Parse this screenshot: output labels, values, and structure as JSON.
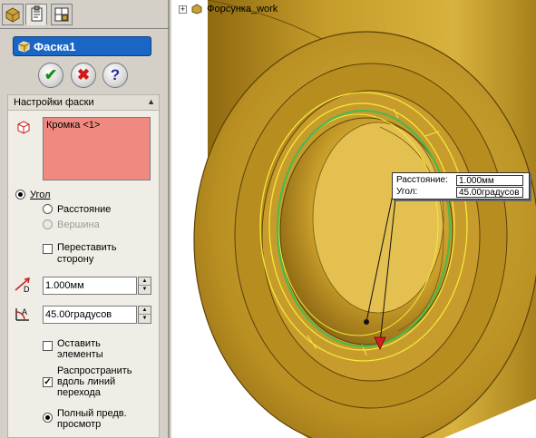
{
  "property_manager": {
    "tabs": [
      {
        "icon": "feature-manager-icon",
        "active": false
      },
      {
        "icon": "property-manager-icon",
        "active": true
      },
      {
        "icon": "configuration-manager-icon",
        "active": false
      }
    ],
    "feature_title": "Фаска1",
    "buttons": {
      "ok_icon": "checkmark-icon",
      "cancel_icon": "x-icon",
      "help_label": "?"
    },
    "group_title": "Настройки фаски",
    "selection": {
      "items": [
        "Кромка <1>"
      ]
    },
    "options": {
      "angle_label": "Угол",
      "distance_label": "Расстояние",
      "vertex_label": "Вершина",
      "flip_label_1": "Переставить",
      "flip_label_2": "сторону",
      "distance_value": "1.000мм",
      "angle_value": "45.00градусов",
      "keep_label_1": "Оставить",
      "keep_label_2": "элементы",
      "propagate_label_1": "Распространить",
      "propagate_label_2": "вдоль линий",
      "propagate_label_3": "перехода",
      "full_preview_label_1": "Полный предв.",
      "full_preview_label_2": "просмотр"
    }
  },
  "viewport": {
    "tree_item": "Форсунка_work",
    "callout": {
      "distance_label": "Расстояние:",
      "distance_value": "1.000мм",
      "angle_label": "Угол:",
      "angle_value": "45.00градусов"
    }
  },
  "colors": {
    "part": "#c89a1e",
    "selection": "#f08a80",
    "edge_highlight": "#4db84d",
    "preview_edges": "#f5e83a"
  }
}
